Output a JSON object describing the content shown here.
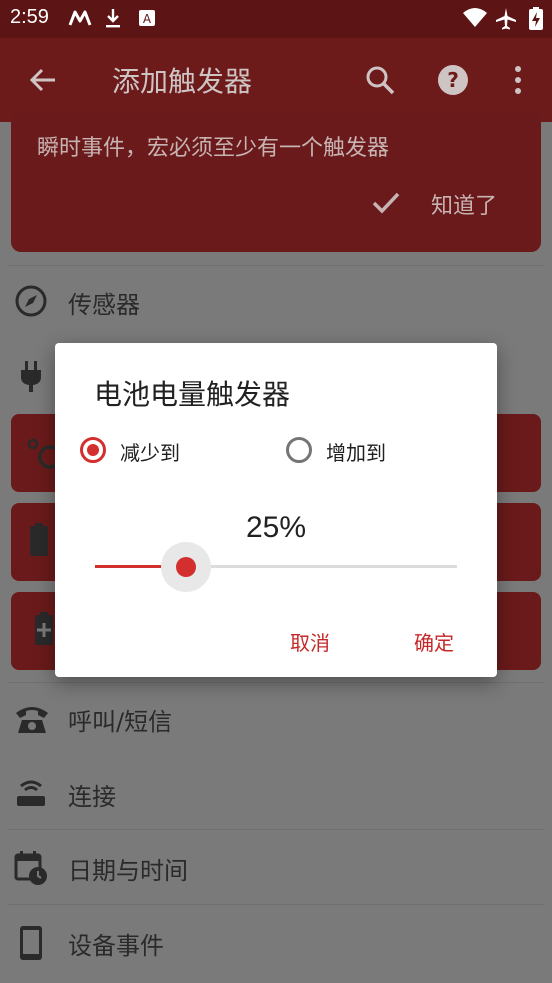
{
  "status_bar": {
    "time": "2:59"
  },
  "app_bar": {
    "title": "添加触发器",
    "icons": [
      "back-arrow-icon",
      "search-icon",
      "help-icon",
      "more-vert-icon"
    ]
  },
  "info_card": {
    "text": "瞬时事件，宏必须至少有一个触发器",
    "ack_label": "知道了"
  },
  "categories": {
    "sensor": "传感器",
    "call_sms": "呼叫/短信",
    "connection": "连接",
    "date_time": "日期与时间",
    "device_event": "设备事件"
  },
  "dialog": {
    "title": "电池电量触发器",
    "option_decrease": "减少到",
    "option_increase": "增加到",
    "selected_option": "减少到",
    "percent_label": "25%",
    "slider_value": 25,
    "cancel_label": "取消",
    "ok_label": "确定"
  },
  "colors": {
    "accent": "#d32f2f",
    "app_bar": "#6c1a1a",
    "status_bar": "#5c1414",
    "scrim": "#7a7a7a"
  }
}
